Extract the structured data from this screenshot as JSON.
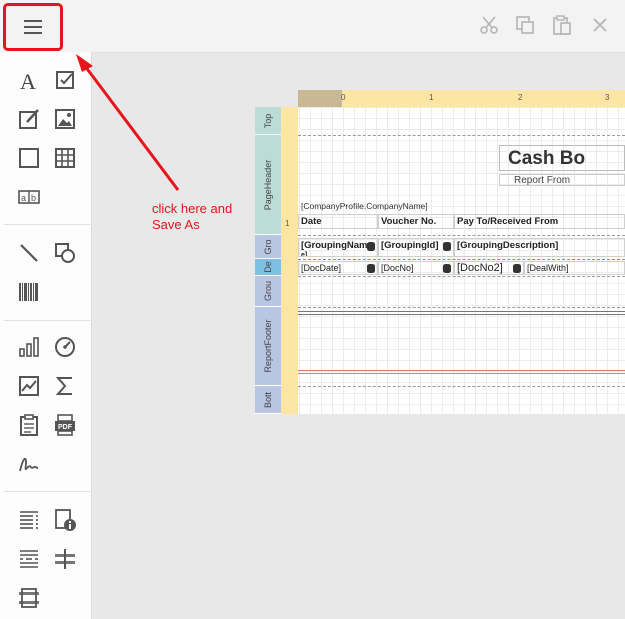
{
  "toolbar": {
    "menu_icon": "hamburger-menu-icon",
    "actions": [
      "cut-icon",
      "copy-icon",
      "paste-icon",
      "delete-icon"
    ]
  },
  "annotation": {
    "text_line1": "click here and",
    "text_line2": "Save As",
    "color": "#e8141b"
  },
  "toolbox": {
    "groups": [
      [
        "label-icon",
        "checkbox-icon",
        "rich-text-icon",
        "picture-box-icon",
        "panel-icon",
        "table-icon",
        "character-comb-icon"
      ],
      [
        "line-icon",
        "shape-icon",
        "barcode-icon"
      ],
      [
        "chart-icon",
        "gauge-icon",
        "sparkline-icon",
        "summary-icon",
        "subreport-icon",
        "pdf-content-icon",
        "signature-icon"
      ],
      [
        "table-of-contents-icon",
        "page-info-icon",
        "page-break-icon",
        "cross-band-line-icon",
        "cross-band-box-icon"
      ]
    ]
  },
  "report": {
    "bands": [
      "Top",
      "PageHeader",
      "Gro",
      "De",
      "Grou",
      "ReportFooter",
      "Bott"
    ],
    "ruler_h": [
      "0",
      "1",
      "2",
      "3"
    ],
    "ruler_v": [
      "1"
    ],
    "title": "Cash Bo",
    "subtitle": "Report From",
    "company": "[CompanyProfile.CompanyName]",
    "headers": [
      "Date",
      "Voucher No.",
      "Pay To/Received From"
    ],
    "group_fields": [
      "[GroupingNam",
      "[GroupingId]",
      "[GroupingDescription]"
    ],
    "group_wrap": "e]",
    "detail_fields": [
      "[DocDate]",
      "[DocNo]",
      "[DocNo2]",
      "[DealWith]"
    ]
  }
}
